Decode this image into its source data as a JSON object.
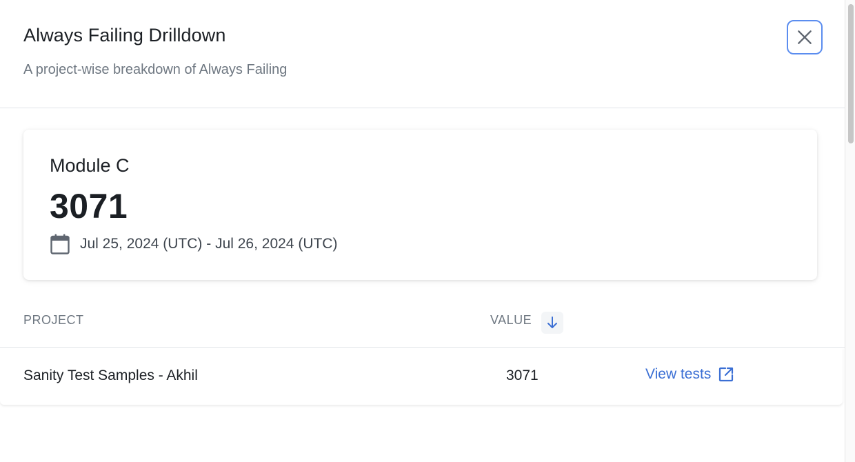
{
  "header": {
    "title": "Always Failing Drilldown",
    "subtitle": "A project-wise breakdown of Always Failing",
    "close_icon": "close-icon"
  },
  "summary_card": {
    "label": "Module C",
    "value": "3071",
    "date_icon": "calendar-icon",
    "date_range": "Jul 25, 2024 (UTC) - Jul 26, 2024 (UTC)"
  },
  "table": {
    "columns": {
      "project": "PROJECT",
      "value": "VALUE"
    },
    "sort_icon": "arrow-down-icon",
    "rows": [
      {
        "project": "Sanity Test Samples - Akhil",
        "value": "3071",
        "link_label": "View tests",
        "link_icon": "external-link-icon"
      }
    ]
  },
  "colors": {
    "accent": "#3b6fd4",
    "focus_ring": "#5b8def",
    "muted_text": "#6e7781",
    "primary_text": "#1b1f24"
  }
}
